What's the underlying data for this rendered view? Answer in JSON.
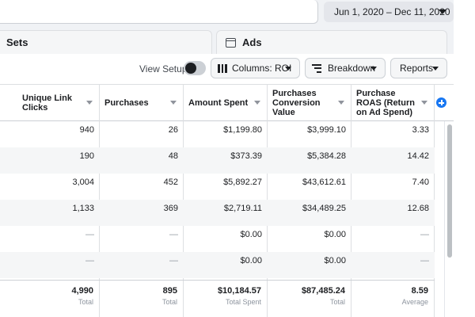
{
  "header": {
    "date_range": "Jun 1, 2020 – Dec 11, 2020"
  },
  "level_tabs": [
    {
      "label": "Sets"
    },
    {
      "label": "Ads"
    }
  ],
  "toolbar": {
    "view_setup_label": "View Setup",
    "view_setup_on": false,
    "columns_label": "Columns: ROI",
    "breakdown_label": "Breakdown",
    "reports_label": "Reports"
  },
  "table": {
    "columns": [
      "Unique Link\nClicks",
      "Purchases",
      "Amount Spent",
      "Purchases\nConversion\nValue",
      "Purchase\nROAS (Return\non Ad Spend)"
    ],
    "rows": [
      [
        "940",
        "26",
        "$1,199.80",
        "$3,999.10",
        "3.33"
      ],
      [
        "190",
        "48",
        "$373.39",
        "$5,384.28",
        "14.42"
      ],
      [
        "3,004",
        "452",
        "$5,892.27",
        "$43,612.61",
        "7.40"
      ],
      [
        "1,133",
        "369",
        "$2,719.11",
        "$34,489.25",
        "12.68"
      ],
      [
        "—",
        "—",
        "$0.00",
        "$0.00",
        "—"
      ],
      [
        "—",
        "—",
        "$0.00",
        "$0.00",
        "—"
      ]
    ],
    "totals": [
      {
        "value": "4,990",
        "label": "Total"
      },
      {
        "value": "895",
        "label": "Total"
      },
      {
        "value": "$10,184.57",
        "label": "Total Spent"
      },
      {
        "value": "$87,485.24",
        "label": "Total"
      },
      {
        "value": "8.59",
        "label": "Average"
      }
    ]
  },
  "colors": {
    "accent": "#1877f2",
    "background": "#f0f2f5",
    "row_alt": "#f5f6f7",
    "border": "#dddfe2"
  }
}
